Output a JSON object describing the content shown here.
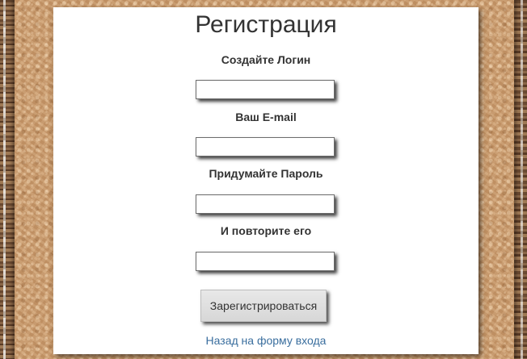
{
  "page": {
    "title": "Регистрация"
  },
  "form": {
    "login_label": "Создайте Логин",
    "login_value": "",
    "email_label": "Ваш E-mail",
    "email_value": "",
    "password_label": "Придумайте Пароль",
    "password_value": "",
    "password_repeat_label": "И повторите его",
    "password_repeat_value": "",
    "submit_label": "Зарегистрироваться",
    "back_link": "Назад на форму входа"
  },
  "colors": {
    "panel_background": "#ffffff",
    "text": "#333333",
    "link": "#3a6e9e",
    "page_background": "#c89a6c"
  }
}
